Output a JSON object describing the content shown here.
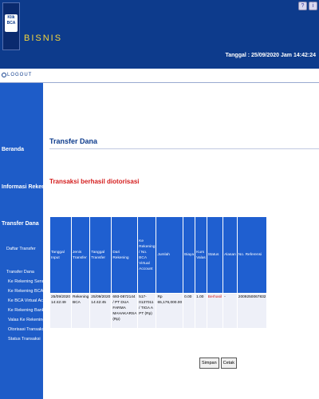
{
  "header": {
    "logo_text": "Klik BCA",
    "brand": "BISNIS",
    "date_line": "Tanggal : 25/09/2020 Jam 14:42:24"
  },
  "logout": {
    "label": "LOGOUT"
  },
  "sidebar": {
    "items": [
      {
        "label": "Beranda"
      },
      {
        "label": "Informasi Rekening"
      },
      {
        "label": "Transfer Dana"
      }
    ],
    "sub_items": [
      {
        "label": "Daftar Transfer"
      },
      {
        "label": "Transfer Dana"
      },
      {
        "label": "Ke Rekening Sendiri"
      },
      {
        "label": "Ke Rekening BCA Lainnya"
      },
      {
        "label": "Ke BCA Virtual Account"
      },
      {
        "label": "Ke Rekening Bank Lain D..."
      },
      {
        "label": "Valas Ke Rekening Bank L..."
      },
      {
        "label": "Otorisasi Transaksi"
      },
      {
        "label": "Status Transaksi"
      }
    ]
  },
  "main": {
    "page_title": "Transfer Dana",
    "success_message": "Transaksi berhasil diotorisasi",
    "table": {
      "headers": [
        "Tanggal Input",
        "Jenis Transfer",
        "Tanggal Transfer",
        "Dari Rekening",
        "Ke Rekening / No. BCA Virtual Account",
        "Jumlah",
        "Biaya",
        "Kurs Valas",
        "Status",
        "Alasan",
        "No. Referensi"
      ],
      "rows": [
        [
          "25/09/2020 14:42:49",
          "Rekening BCA",
          "25/09/2020 14:42:45",
          "693-0872144 / PT DUA FARMA MAHAKARSA (Rp)",
          "517-0137011 / TIGA A PT (Rp)",
          "Rp 65,176,000.00",
          "0.00",
          "1.00",
          "Berhasil",
          "-",
          "2009250067832"
        ]
      ]
    },
    "buttons": {
      "save": "Simpan",
      "print": "Cetak"
    }
  },
  "colors": {
    "header_bg": "#0d3b8c",
    "brand_yellow": "#f4d53b",
    "sidebar_bg": "#1e5cc8",
    "table_header_bg": "#1f5fd0",
    "alert_red": "#d41d1d"
  }
}
